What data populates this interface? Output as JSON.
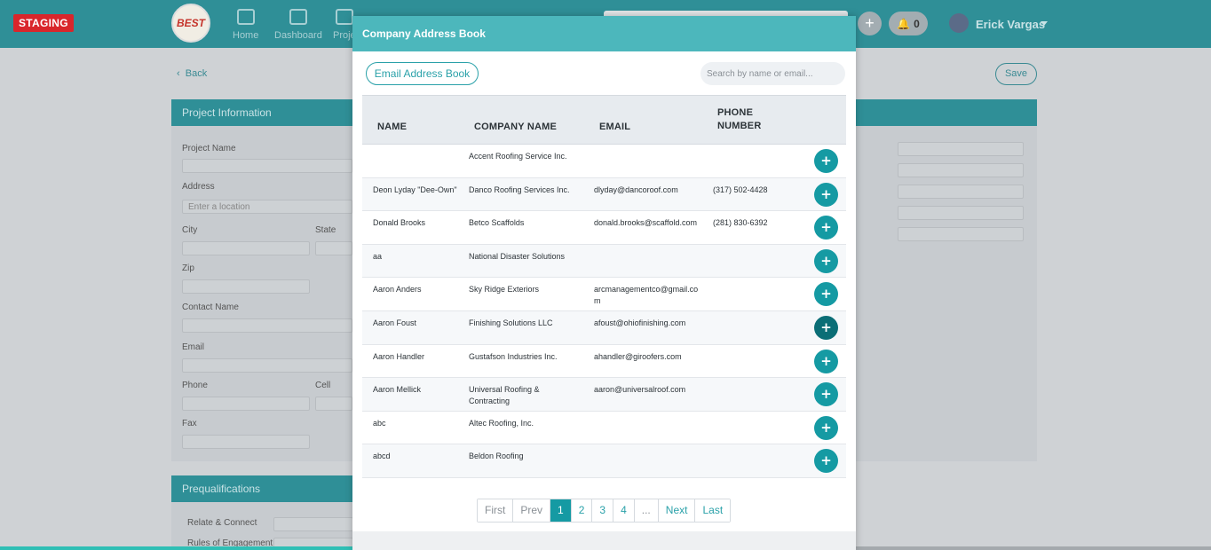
{
  "topbar": {
    "staging_label": "STAGING",
    "logo_text": "BEST",
    "nav": [
      {
        "label": "Home",
        "icon": "bar-chart-icon"
      },
      {
        "label": "Dashboard",
        "icon": "dashboard-icon"
      },
      {
        "label": "Proje",
        "icon": "folder-icon"
      }
    ],
    "notifications_count": "0",
    "user_name": "Erick Vargas"
  },
  "page": {
    "back_label": "Back",
    "save_label": "Save",
    "project_info_title": "Project Information",
    "fields": {
      "project_name": "Project Name",
      "address": "Address",
      "address_placeholder": "Enter a location",
      "city": "City",
      "state": "State",
      "zip": "Zip",
      "contact_name": "Contact Name",
      "email": "Email",
      "phone": "Phone",
      "cell": "Cell",
      "fax": "Fax"
    },
    "prequal_title": "Prequalifications",
    "prequal_fields": {
      "relate": "Relate & Connect",
      "rules": "Rules of Engagement"
    }
  },
  "modal": {
    "title": "Company Address Book",
    "email_book_label": "Email Address Book",
    "search_placeholder": "Search by name or email...",
    "columns": {
      "name": "NAME",
      "company": "COMPANY NAME",
      "email": "EMAIL",
      "phone_line1": "PHONE",
      "phone_line2": "NUMBER"
    },
    "rows": [
      {
        "name": "",
        "company": "Accent Roofing Service Inc.",
        "email": "",
        "phone": ""
      },
      {
        "name": "Deon Lyday \"Dee-Own\"",
        "company": "Danco Roofing Services Inc.",
        "email": "dlyday@dancoroof.com",
        "phone": "(317) 502-4428"
      },
      {
        "name": "Donald Brooks",
        "company": "Betco Scaffolds",
        "email": "donald.brooks@scaffold.com",
        "phone": "(281) 830-6392"
      },
      {
        "name": "aa",
        "company": "National Disaster Solutions",
        "email": "",
        "phone": ""
      },
      {
        "name": "Aaron Anders",
        "company": "Sky Ridge Exteriors",
        "email": "arcmanagementco@gmail.com",
        "phone": ""
      },
      {
        "name": "Aaron Foust",
        "company": "Finishing Solutions LLC",
        "email": "afoust@ohiofinishing.com",
        "phone": ""
      },
      {
        "name": "Aaron Handler",
        "company": "Gustafson Industries Inc.",
        "email": "ahandler@giroofers.com",
        "phone": ""
      },
      {
        "name": "Aaron Mellick",
        "company": "Universal Roofing & Contracting",
        "email": "aaron@universalroof.com",
        "phone": ""
      },
      {
        "name": "abc",
        "company": "Altec Roofing, Inc.",
        "email": "",
        "phone": ""
      },
      {
        "name": "abcd",
        "company": "Beldon Roofing",
        "email": "",
        "phone": ""
      }
    ],
    "add_label": "+",
    "pagination": {
      "first": "First",
      "prev": "Prev",
      "pages": [
        "1",
        "2",
        "3",
        "4"
      ],
      "ellipsis": "...",
      "next": "Next",
      "last": "Last",
      "current": "1"
    }
  },
  "colors": {
    "teal": "#2f8f97",
    "modal_header": "#4cb7bc",
    "add_button": "#159aa3",
    "staging": "#d9262b"
  }
}
